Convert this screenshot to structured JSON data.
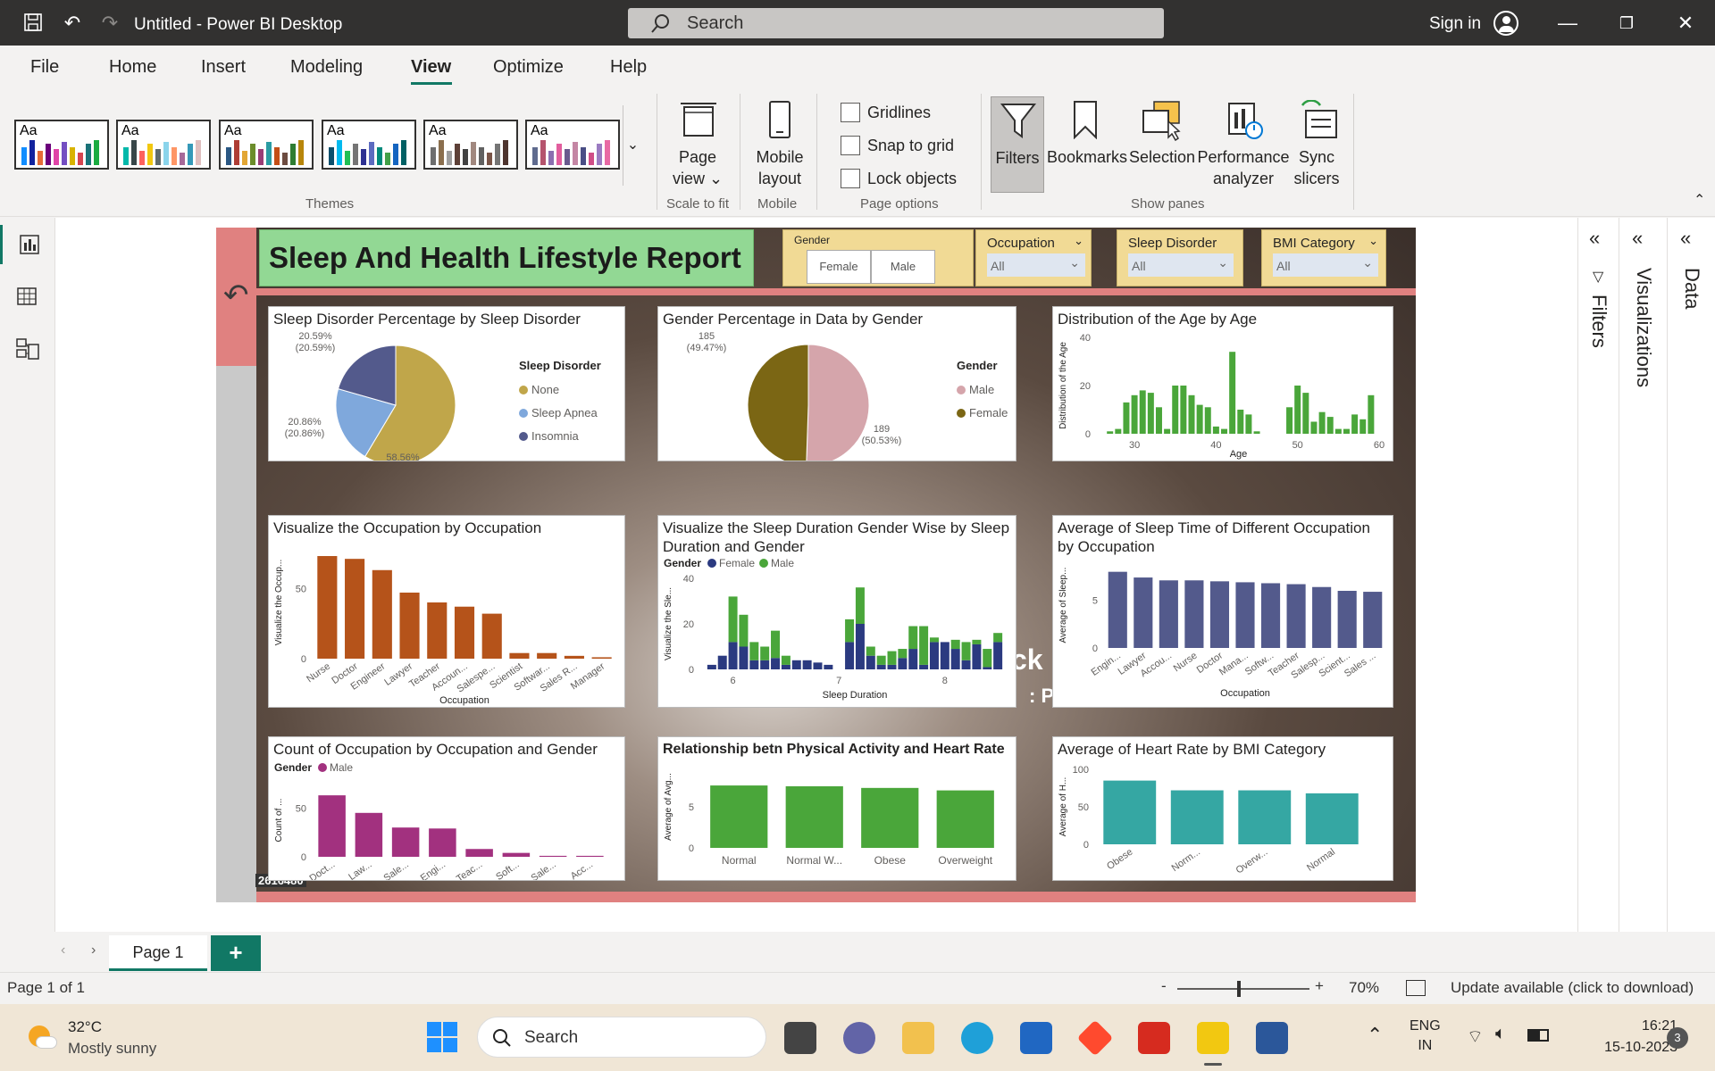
{
  "titlebar": {
    "title": "Untitled - Power BI Desktop",
    "search_placeholder": "Search",
    "signin": "Sign in"
  },
  "ribbon": {
    "tabs": [
      "File",
      "Home",
      "Insert",
      "Modeling",
      "View",
      "Optimize",
      "Help"
    ],
    "active_tab": "View",
    "themes_label": "Themes",
    "theme_aa": "Aa",
    "page_view": {
      "label1": "Page",
      "label2": "view",
      "group": "Scale to fit"
    },
    "mobile": {
      "label1": "Mobile",
      "label2": "layout",
      "group": "Mobile"
    },
    "page_options": {
      "gridlines": "Gridlines",
      "snap": "Snap to grid",
      "lock": "Lock objects",
      "group": "Page options"
    },
    "show_panes": {
      "filters": "Filters",
      "bookmarks": "Bookmarks",
      "selection": "Selection",
      "performance1": "Performance",
      "performance2": "analyzer",
      "sync1": "Sync",
      "sync2": "slicers",
      "group": "Show panes"
    }
  },
  "report": {
    "title": "Sleep And Health Lifestyle Report",
    "slicers": {
      "gender": {
        "title": "Gender",
        "options": [
          "Female",
          "Male"
        ]
      },
      "occupation": {
        "title": "Occupation",
        "value": "All"
      },
      "sleep_disorder": {
        "title": "Sleep Disorder",
        "value": "All"
      },
      "bmi": {
        "title": "BMI Category",
        "value": "All"
      }
    },
    "background_fragments": [
      "ck",
      ": P",
      "2616480"
    ],
    "colors": {
      "banner": "#92d894",
      "green": "#4aa63a",
      "orange": "#b5531a",
      "navy": "#535a8c",
      "magenta": "#a2317f",
      "teal": "#35a7a3",
      "pink_band": "#e08180"
    }
  },
  "chart_data": [
    {
      "id": "sleep_disorder_pie",
      "type": "pie",
      "title": "Sleep Disorder Percentage by Sleep Disorder",
      "legend_title": "Sleep Disorder",
      "categories": [
        "None",
        "Sleep Apnea",
        "Insomnia"
      ],
      "values": [
        58.56,
        20.86,
        20.59
      ],
      "labels": [
        "58.56% (58.56%)",
        "20.86% (20.86%)",
        "20.59% (20.59%)"
      ],
      "colors": [
        "#c0a64a",
        "#7fa8dc",
        "#535a8c"
      ],
      "legend_position": "right"
    },
    {
      "id": "gender_pie",
      "type": "pie",
      "title": "Gender Percentage in Data by Gender",
      "legend_title": "Gender",
      "categories": [
        "Male",
        "Female"
      ],
      "values": [
        189,
        185
      ],
      "labels": [
        "189 (50.53%)",
        "185 (49.47%)"
      ],
      "colors": [
        "#d5a5ab",
        "#7b6614"
      ],
      "legend_position": "right"
    },
    {
      "id": "age_distribution",
      "type": "bar",
      "title": "Distribution of the Age by Age",
      "xlabel": "Age",
      "ylabel": "Distribution of the Age",
      "xticks": [
        30,
        40,
        50,
        60
      ],
      "yticks": [
        0,
        20,
        40
      ],
      "ylim": [
        0,
        40
      ],
      "x": [
        27,
        28,
        29,
        30,
        31,
        32,
        33,
        34,
        35,
        36,
        37,
        38,
        39,
        40,
        41,
        42,
        43,
        44,
        45,
        49,
        50,
        51,
        52,
        53,
        54,
        55,
        56,
        57,
        58,
        59
      ],
      "values": [
        1,
        2,
        13,
        16,
        18,
        17,
        11,
        2,
        20,
        20,
        16,
        12,
        11,
        3,
        2,
        34,
        10,
        8,
        1,
        11,
        20,
        17,
        5,
        9,
        7,
        2,
        2,
        8,
        6,
        16
      ],
      "color": "#4aa63a"
    },
    {
      "id": "occupation_count",
      "type": "bar",
      "title": "Visualize the Occupation by Occupation",
      "xlabel": "Occupation",
      "ylabel": "Visualize the Occup...",
      "yticks": [
        0,
        50
      ],
      "ylim": [
        0,
        80
      ],
      "categories": [
        "Nurse",
        "Doctor",
        "Engineer",
        "Lawyer",
        "Teacher",
        "Accoun...",
        "Salespe...",
        "Scientist",
        "Softwar...",
        "Sales R...",
        "Manager"
      ],
      "values": [
        73,
        71,
        63,
        47,
        40,
        37,
        32,
        4,
        4,
        2,
        1
      ],
      "color": "#b5531a"
    },
    {
      "id": "sleep_duration_gender",
      "type": "bar",
      "title": "Visualize the Sleep Duration Gender Wise by Sleep Duration and Gender",
      "legend_title": "Gender",
      "xlabel": "Sleep Duration",
      "ylabel": "Visualize the Sle...",
      "xticks": [
        6,
        7,
        8
      ],
      "yticks": [
        0,
        20,
        40
      ],
      "ylim": [
        0,
        40
      ],
      "x": [
        5.8,
        5.9,
        6.0,
        6.1,
        6.2,
        6.3,
        6.4,
        6.5,
        6.6,
        6.7,
        6.8,
        6.9,
        7.1,
        7.2,
        7.3,
        7.4,
        7.5,
        7.6,
        7.7,
        7.8,
        7.9,
        8.0,
        8.1,
        8.2,
        8.3,
        8.4,
        8.5
      ],
      "series": [
        {
          "name": "Female",
          "color": "#2b3a80",
          "values": [
            2,
            6,
            12,
            10,
            4,
            4,
            5,
            2,
            4,
            4,
            3,
            2,
            12,
            20,
            6,
            2,
            2,
            5,
            9,
            2,
            12,
            12,
            9,
            4,
            11,
            1,
            12
          ]
        },
        {
          "name": "Male",
          "color": "#4aa63a",
          "values": [
            0,
            0,
            20,
            14,
            8,
            6,
            12,
            4,
            0,
            0,
            0,
            0,
            10,
            16,
            4,
            4,
            6,
            4,
            10,
            17,
            2,
            0,
            4,
            8,
            2,
            8,
            4
          ]
        }
      ],
      "legend_position": "top-left"
    },
    {
      "id": "avg_sleep_occupation",
      "type": "bar",
      "title": "Average of Sleep Time of Different Occupation by Occupation",
      "xlabel": "Occupation",
      "ylabel": "Average of Sleep...",
      "yticks": [
        0,
        5
      ],
      "ylim": [
        0,
        9
      ],
      "categories": [
        "Engin...",
        "Lawyer",
        "Accou...",
        "Nurse",
        "Doctor",
        "Mana...",
        "Softw...",
        "Teacher",
        "Salesp...",
        "Scient...",
        "Sales ..."
      ],
      "values": [
        8.0,
        7.4,
        7.1,
        7.1,
        7.0,
        6.9,
        6.8,
        6.7,
        6.4,
        6.0,
        5.9
      ],
      "color": "#535a8c"
    },
    {
      "id": "occupation_gender_count",
      "type": "bar",
      "title": "Count of Occupation by Occupation and Gender",
      "legend_title": "Gender",
      "ylabel": "Count of ...",
      "yticks": [
        0,
        50
      ],
      "ylim": [
        0,
        75
      ],
      "categories": [
        "Doct...",
        "Law...",
        "Sale...",
        "Engi...",
        "Teac...",
        "Soft...",
        "Sale...",
        "Acc..."
      ],
      "series": [
        {
          "name": "Male",
          "color": "#a2317f",
          "values": [
            63,
            45,
            30,
            29,
            8,
            4,
            1,
            1
          ]
        }
      ],
      "legend_position": "top-left"
    },
    {
      "id": "activity_heart_rate",
      "type": "bar",
      "title": "Relationship betn Physical Activity and Heart Rate",
      "ylabel": "Average of Avg...",
      "yticks": [
        0,
        5
      ],
      "ylim": [
        0,
        10
      ],
      "categories": [
        "Normal",
        "Normal W...",
        "Obese",
        "Overweight"
      ],
      "values": [
        7.6,
        7.5,
        7.3,
        7.0
      ],
      "color": "#4aa63a"
    },
    {
      "id": "heart_rate_bmi",
      "type": "bar",
      "title": "Average of Heart Rate by BMI Category",
      "ylabel": "Average of H...",
      "yticks": [
        0,
        50,
        100
      ],
      "ylim": [
        0,
        100
      ],
      "categories": [
        "Obese",
        "Norm...",
        "Overw...",
        "Normal"
      ],
      "values": [
        85,
        72,
        72,
        68
      ],
      "color": "#35a7a3"
    }
  ],
  "left_rail": {
    "icons": [
      "report-view-icon",
      "table-view-icon",
      "model-view-icon"
    ]
  },
  "right_panes": {
    "filters": "Filters",
    "visualizations": "Visualizations",
    "data": "Data"
  },
  "pages": {
    "tabs": [
      "Page 1"
    ],
    "add": "+"
  },
  "statusbar": {
    "page": "Page 1 of 1",
    "zoom_minus": "-",
    "zoom_plus": "+",
    "zoom": "70%",
    "update": "Update available (click to download)",
    "zoom_fraction": 0.45
  },
  "taskbar": {
    "weather_temp": "32°C",
    "weather_desc": "Mostly sunny",
    "search": "Search",
    "lang1": "ENG",
    "lang2": "IN",
    "time": "16:21",
    "date": "15-10-2023",
    "notifications": "3"
  }
}
